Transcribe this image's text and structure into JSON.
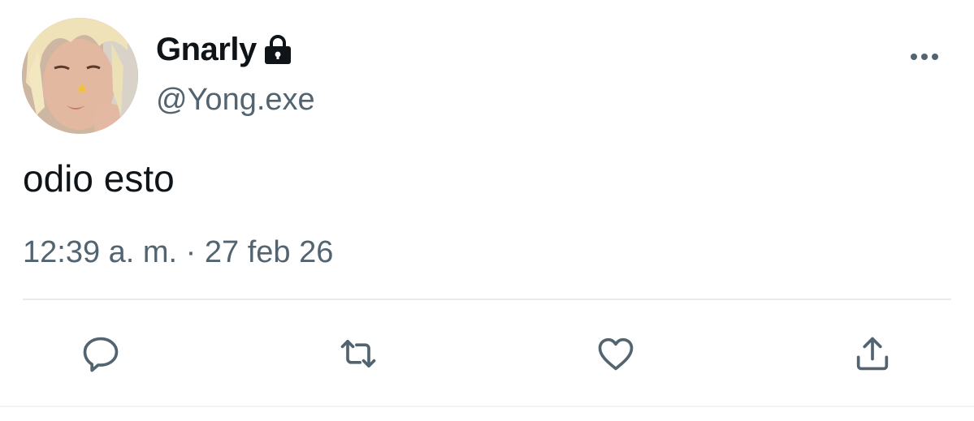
{
  "tweet": {
    "display_name": "Gnarly",
    "handle": "@Yong.exe",
    "text": "odio esto",
    "timestamp": "12:39 a. m. · 27 feb 26",
    "protected_icon": "lock-icon",
    "avatar_icon": "profile-photo"
  },
  "actions": [
    {
      "name": "reply",
      "icon": "reply-icon"
    },
    {
      "name": "retweet",
      "icon": "retweet-icon"
    },
    {
      "name": "like",
      "icon": "heart-icon"
    },
    {
      "name": "share",
      "icon": "share-icon"
    }
  ],
  "colors": {
    "text_primary": "#0f1419",
    "text_secondary": "#536471",
    "divider": "#e6ebee",
    "background": "#ffffff"
  }
}
